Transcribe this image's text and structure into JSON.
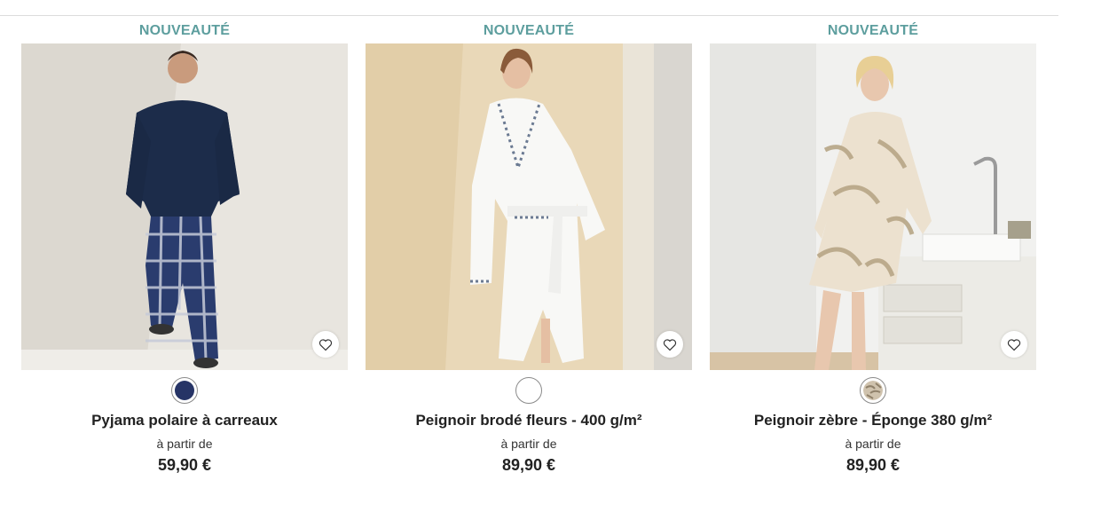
{
  "products": [
    {
      "badge": "NOUVEAUTÉ",
      "title": "Pyjama polaire à carreaux",
      "from_label": "à partir de",
      "price": "59,90 €",
      "swatch_color": "#263466",
      "swatch_icon": "solid-color"
    },
    {
      "badge": "NOUVEAUTÉ",
      "title": "Peignoir brodé fleurs - 400 g/m²",
      "from_label": "à partir de",
      "price": "89,90 €",
      "swatch_color": "#ffffff",
      "swatch_icon": "solid-color"
    },
    {
      "badge": "NOUVEAUTÉ",
      "title": "Peignoir zèbre - Éponge 380 g/m²",
      "from_label": "à partir de",
      "price": "89,90 €",
      "swatch_color": "#b9ab98",
      "swatch_icon": "zebra-pattern"
    }
  ],
  "colors": {
    "badge": "#5d9e9e",
    "text": "#222222"
  },
  "icons": {
    "favorite": "heart-outline-icon"
  }
}
